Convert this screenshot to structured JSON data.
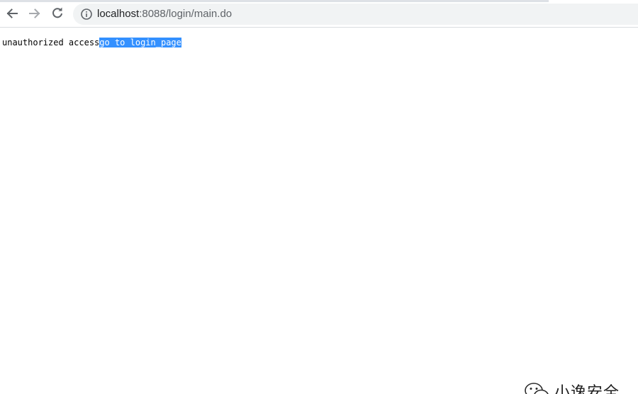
{
  "browser": {
    "address_bar": {
      "url_host": "localhost",
      "url_rest": ":8088/login/main.do"
    },
    "icons": {
      "back": "arrow-left-icon",
      "forward": "arrow-right-icon",
      "reload": "reload-icon",
      "site_info": "info-circle-icon"
    }
  },
  "page": {
    "message_text": "unauthorized access",
    "link_text": "go to login_page",
    "link_highlight_color": "#3390ff"
  },
  "watermark": {
    "text": "小逸安全",
    "logo": "wechat-logo-icon"
  }
}
